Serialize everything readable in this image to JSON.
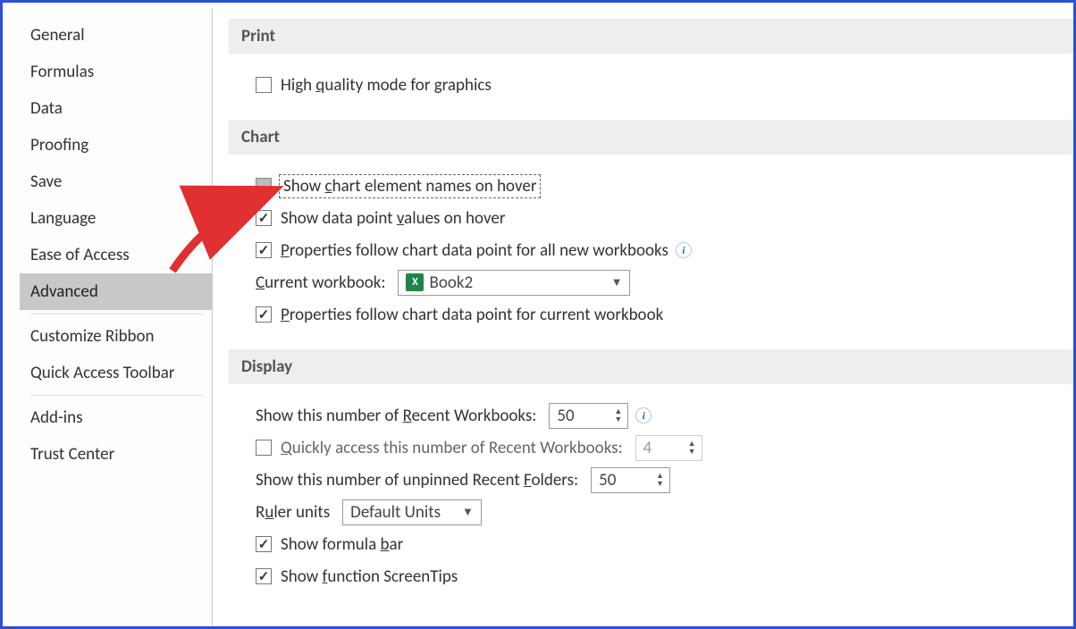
{
  "sidebar": {
    "items": [
      {
        "label": "General"
      },
      {
        "label": "Formulas"
      },
      {
        "label": "Data"
      },
      {
        "label": "Proofing"
      },
      {
        "label": "Save"
      },
      {
        "label": "Language"
      },
      {
        "label": "Ease of Access"
      },
      {
        "label": "Advanced",
        "selected": true
      },
      {
        "label": "Customize Ribbon"
      },
      {
        "label": "Quick Access Toolbar"
      },
      {
        "label": "Add-ins"
      },
      {
        "label": "Trust Center"
      }
    ]
  },
  "sections": {
    "print": {
      "header": "Print",
      "high_quality": "High quality mode for graphics"
    },
    "chart": {
      "header": "Chart",
      "show_names": "Show chart element names on hover",
      "show_values": "Show data point values on hover",
      "props_all": "Properties follow chart data point for all new workbooks",
      "current_wb_label": "Current workbook:",
      "current_wb_value": "Book2",
      "props_current": "Properties follow chart data point for current workbook"
    },
    "display": {
      "header": "Display",
      "recent_wb_label": "Show this number of Recent Workbooks:",
      "recent_wb_value": "50",
      "quick_access_label": "Quickly access this number of Recent Workbooks:",
      "quick_access_value": "4",
      "recent_folders_label": "Show this number of unpinned Recent Folders:",
      "recent_folders_value": "50",
      "ruler_label": "Ruler units",
      "ruler_value": "Default Units",
      "formula_bar": "Show formula bar",
      "screentips": "Show function ScreenTips"
    }
  }
}
